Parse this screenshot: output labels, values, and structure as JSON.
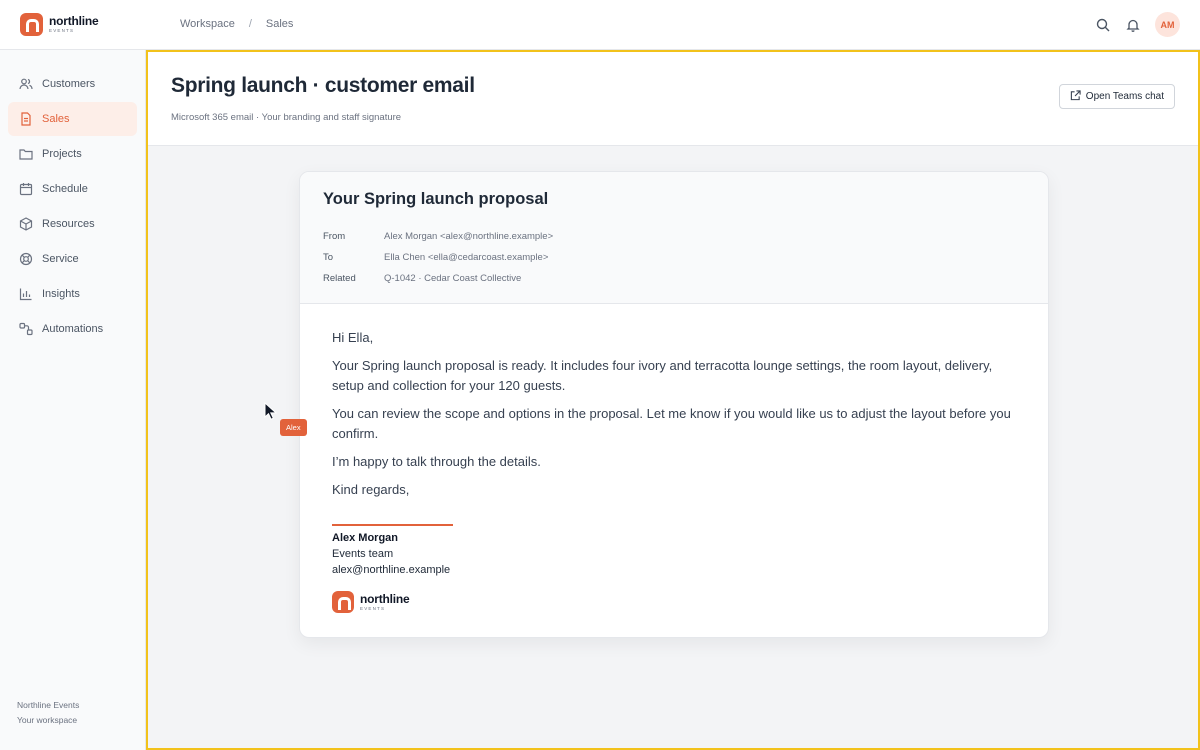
{
  "brand": {
    "name": "northline",
    "sub": "EVENTS",
    "color": "#e2623b"
  },
  "breadcrumb": {
    "items": [
      "Workspace",
      "Sales"
    ],
    "separator": "/"
  },
  "user": {
    "initials": "AM"
  },
  "sidebar": {
    "items": [
      {
        "label": "Customers",
        "icon": "users-icon"
      },
      {
        "label": "Sales",
        "icon": "document-icon",
        "active": true
      },
      {
        "label": "Projects",
        "icon": "folder-icon"
      },
      {
        "label": "Schedule",
        "icon": "calendar-icon"
      },
      {
        "label": "Resources",
        "icon": "box-icon"
      },
      {
        "label": "Service",
        "icon": "lifebuoy-icon"
      },
      {
        "label": "Insights",
        "icon": "bar-chart-icon"
      },
      {
        "label": "Automations",
        "icon": "workflow-icon"
      }
    ],
    "footer": {
      "org": "Northline Events",
      "workspace": "Your workspace"
    }
  },
  "page": {
    "title": "Spring launch · customer email",
    "subtitle": "Microsoft 365 email · Your branding and staff signature",
    "teams_button": "Open Teams chat"
  },
  "email": {
    "subject": "Your Spring launch proposal",
    "meta": [
      {
        "label": "From",
        "value": "Alex Morgan <alex@northline.example>"
      },
      {
        "label": "To",
        "value": "Ella Chen <ella@cedarcoast.example>"
      },
      {
        "label": "Related",
        "value": "Q-1042 · Cedar Coast Collective"
      }
    ],
    "body": [
      "Hi Ella,",
      "Your Spring launch proposal is ready. It includes four ivory and terracotta lounge settings, the room layout, delivery, setup and collection for your 120 guests.",
      "You can review the scope and options in the proposal. Let me know if you would like us to adjust the layout before you confirm.",
      "I’m happy to talk through the details.",
      "Kind regards,"
    ],
    "signature": {
      "name": "Alex Morgan",
      "team": "Events team",
      "email": "alex@northline.example"
    }
  },
  "cursor": {
    "label": "Alex"
  }
}
